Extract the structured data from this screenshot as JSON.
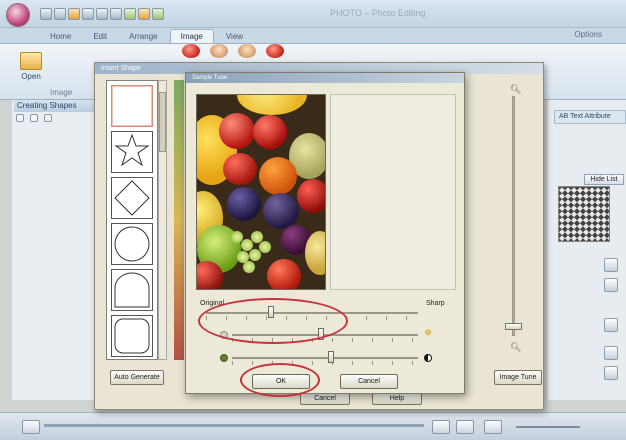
{
  "app": {
    "window_title": "PHOTO – Photo Editing",
    "tabs": [
      "Home",
      "Edit",
      "Arrange",
      "Image",
      "View"
    ],
    "active_tab": "Image",
    "options_label": "Options"
  },
  "ribbon": {
    "open_label": "Open",
    "group_label": "Image"
  },
  "left_pane": {
    "header": "Creating Shapes"
  },
  "right_pane": {
    "tab_label": "AB Text Attribute",
    "hide_list_label": "Hide List"
  },
  "shape_dialog": {
    "title": "Insert Shape",
    "auto_generate_label": "Auto Generate",
    "image_tune_label": "Image Tune",
    "behind_cancel_label": "Cancel",
    "behind_help_label": "Help"
  },
  "tune_dialog": {
    "title": "Sample Tune",
    "slider1_left_label": "Original",
    "slider1_right_label": "Sharp",
    "ok_label": "OK",
    "cancel_label": "Cancel",
    "sliders": [
      {
        "name": "sharpness",
        "value": 0.3
      },
      {
        "name": "brightness",
        "value": 0.48
      },
      {
        "name": "contrast",
        "value": 0.55
      }
    ]
  },
  "colors": {
    "highlight": "#c6343a",
    "ribbon": "#c9d8e6",
    "dialog_bg": "#ece9d8"
  }
}
